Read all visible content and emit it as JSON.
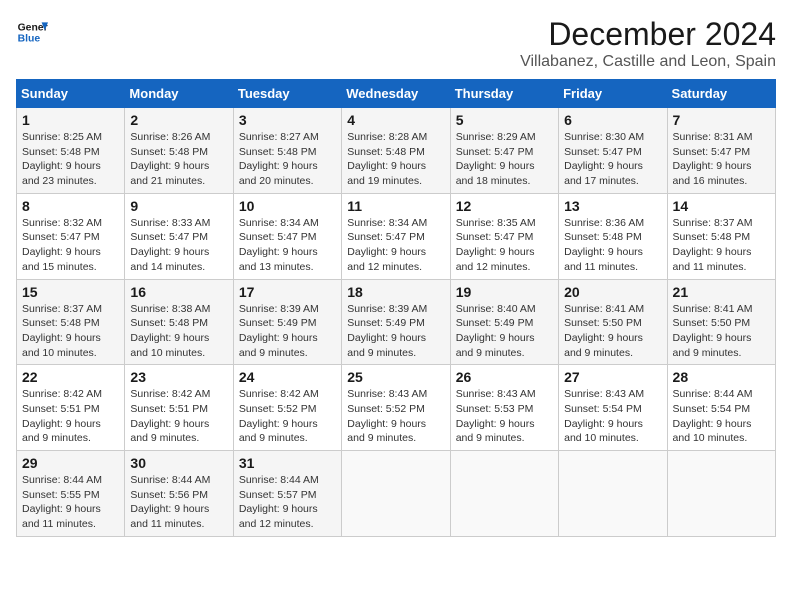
{
  "logo": {
    "line1": "General",
    "line2": "Blue"
  },
  "title": "December 2024",
  "location": "Villabanez, Castille and Leon, Spain",
  "days_of_week": [
    "Sunday",
    "Monday",
    "Tuesday",
    "Wednesday",
    "Thursday",
    "Friday",
    "Saturday"
  ],
  "weeks": [
    [
      {
        "day": "1",
        "sunrise": "8:25 AM",
        "sunset": "5:48 PM",
        "daylight": "9 hours and 23 minutes."
      },
      {
        "day": "2",
        "sunrise": "8:26 AM",
        "sunset": "5:48 PM",
        "daylight": "9 hours and 21 minutes."
      },
      {
        "day": "3",
        "sunrise": "8:27 AM",
        "sunset": "5:48 PM",
        "daylight": "9 hours and 20 minutes."
      },
      {
        "day": "4",
        "sunrise": "8:28 AM",
        "sunset": "5:48 PM",
        "daylight": "9 hours and 19 minutes."
      },
      {
        "day": "5",
        "sunrise": "8:29 AM",
        "sunset": "5:47 PM",
        "daylight": "9 hours and 18 minutes."
      },
      {
        "day": "6",
        "sunrise": "8:30 AM",
        "sunset": "5:47 PM",
        "daylight": "9 hours and 17 minutes."
      },
      {
        "day": "7",
        "sunrise": "8:31 AM",
        "sunset": "5:47 PM",
        "daylight": "9 hours and 16 minutes."
      }
    ],
    [
      {
        "day": "8",
        "sunrise": "8:32 AM",
        "sunset": "5:47 PM",
        "daylight": "9 hours and 15 minutes."
      },
      {
        "day": "9",
        "sunrise": "8:33 AM",
        "sunset": "5:47 PM",
        "daylight": "9 hours and 14 minutes."
      },
      {
        "day": "10",
        "sunrise": "8:34 AM",
        "sunset": "5:47 PM",
        "daylight": "9 hours and 13 minutes."
      },
      {
        "day": "11",
        "sunrise": "8:34 AM",
        "sunset": "5:47 PM",
        "daylight": "9 hours and 12 minutes."
      },
      {
        "day": "12",
        "sunrise": "8:35 AM",
        "sunset": "5:47 PM",
        "daylight": "9 hours and 12 minutes."
      },
      {
        "day": "13",
        "sunrise": "8:36 AM",
        "sunset": "5:48 PM",
        "daylight": "9 hours and 11 minutes."
      },
      {
        "day": "14",
        "sunrise": "8:37 AM",
        "sunset": "5:48 PM",
        "daylight": "9 hours and 11 minutes."
      }
    ],
    [
      {
        "day": "15",
        "sunrise": "8:37 AM",
        "sunset": "5:48 PM",
        "daylight": "9 hours and 10 minutes."
      },
      {
        "day": "16",
        "sunrise": "8:38 AM",
        "sunset": "5:48 PM",
        "daylight": "9 hours and 10 minutes."
      },
      {
        "day": "17",
        "sunrise": "8:39 AM",
        "sunset": "5:49 PM",
        "daylight": "9 hours and 9 minutes."
      },
      {
        "day": "18",
        "sunrise": "8:39 AM",
        "sunset": "5:49 PM",
        "daylight": "9 hours and 9 minutes."
      },
      {
        "day": "19",
        "sunrise": "8:40 AM",
        "sunset": "5:49 PM",
        "daylight": "9 hours and 9 minutes."
      },
      {
        "day": "20",
        "sunrise": "8:41 AM",
        "sunset": "5:50 PM",
        "daylight": "9 hours and 9 minutes."
      },
      {
        "day": "21",
        "sunrise": "8:41 AM",
        "sunset": "5:50 PM",
        "daylight": "9 hours and 9 minutes."
      }
    ],
    [
      {
        "day": "22",
        "sunrise": "8:42 AM",
        "sunset": "5:51 PM",
        "daylight": "9 hours and 9 minutes."
      },
      {
        "day": "23",
        "sunrise": "8:42 AM",
        "sunset": "5:51 PM",
        "daylight": "9 hours and 9 minutes."
      },
      {
        "day": "24",
        "sunrise": "8:42 AM",
        "sunset": "5:52 PM",
        "daylight": "9 hours and 9 minutes."
      },
      {
        "day": "25",
        "sunrise": "8:43 AM",
        "sunset": "5:52 PM",
        "daylight": "9 hours and 9 minutes."
      },
      {
        "day": "26",
        "sunrise": "8:43 AM",
        "sunset": "5:53 PM",
        "daylight": "9 hours and 9 minutes."
      },
      {
        "day": "27",
        "sunrise": "8:43 AM",
        "sunset": "5:54 PM",
        "daylight": "9 hours and 10 minutes."
      },
      {
        "day": "28",
        "sunrise": "8:44 AM",
        "sunset": "5:54 PM",
        "daylight": "9 hours and 10 minutes."
      }
    ],
    [
      {
        "day": "29",
        "sunrise": "8:44 AM",
        "sunset": "5:55 PM",
        "daylight": "9 hours and 11 minutes."
      },
      {
        "day": "30",
        "sunrise": "8:44 AM",
        "sunset": "5:56 PM",
        "daylight": "9 hours and 11 minutes."
      },
      {
        "day": "31",
        "sunrise": "8:44 AM",
        "sunset": "5:57 PM",
        "daylight": "9 hours and 12 minutes."
      },
      null,
      null,
      null,
      null
    ]
  ]
}
